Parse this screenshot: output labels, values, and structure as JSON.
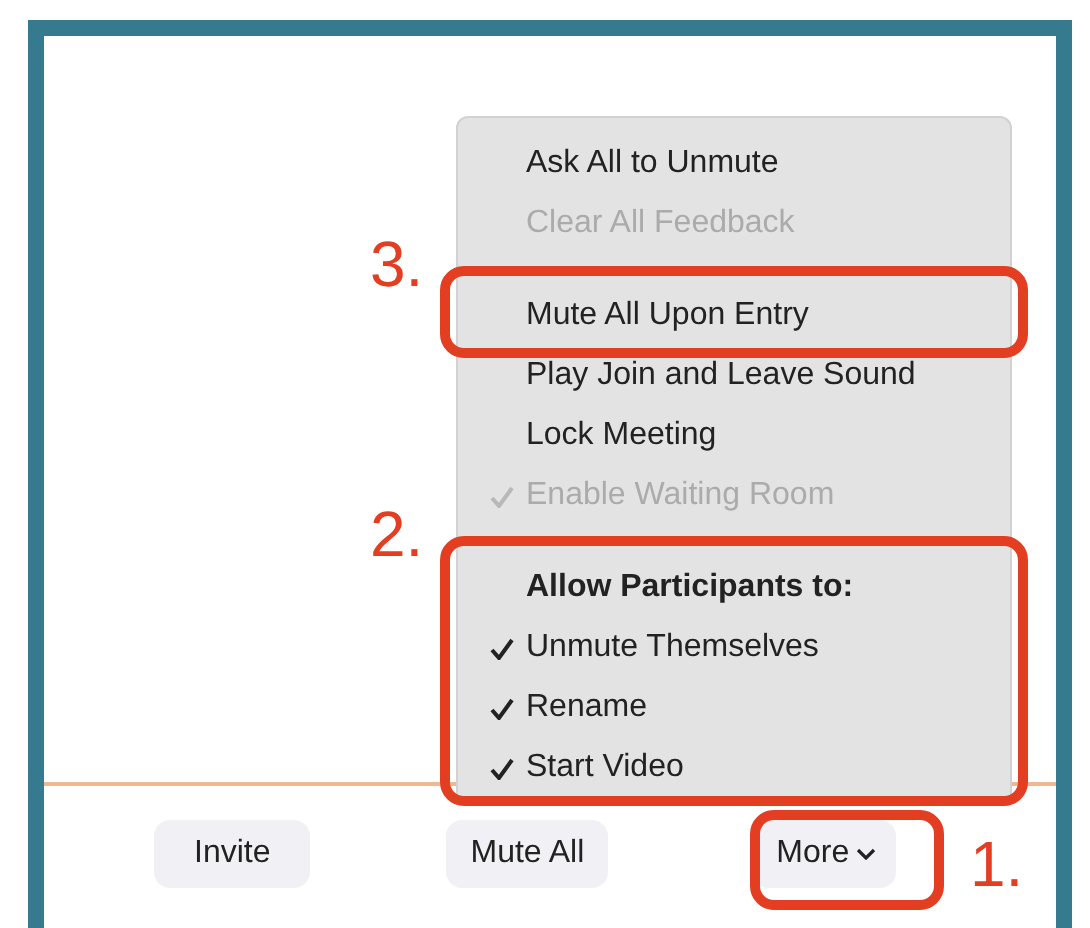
{
  "menu": {
    "items": [
      {
        "kind": "item",
        "label": "Ask All to Unmute",
        "disabled": false,
        "checked": false
      },
      {
        "kind": "item",
        "label": "Clear All Feedback",
        "disabled": true,
        "checked": false
      },
      {
        "kind": "separator"
      },
      {
        "kind": "item",
        "label": "Mute All Upon Entry",
        "disabled": false,
        "checked": false
      },
      {
        "kind": "item",
        "label": "Play Join and Leave Sound",
        "disabled": false,
        "checked": false
      },
      {
        "kind": "item",
        "label": "Lock Meeting",
        "disabled": false,
        "checked": false
      },
      {
        "kind": "item",
        "label": "Enable Waiting Room",
        "disabled": true,
        "checked": true
      },
      {
        "kind": "separator"
      },
      {
        "kind": "header",
        "label": "Allow Participants to:"
      },
      {
        "kind": "item",
        "label": "Unmute Themselves",
        "disabled": false,
        "checked": true
      },
      {
        "kind": "item",
        "label": "Rename",
        "disabled": false,
        "checked": true
      },
      {
        "kind": "item",
        "label": "Start Video",
        "disabled": false,
        "checked": true
      }
    ]
  },
  "buttons": [
    {
      "label": "Invite"
    },
    {
      "label": "Mute All"
    },
    {
      "label": "More",
      "dropdown": true
    }
  ],
  "annotations": [
    "3.",
    "2.",
    "1."
  ]
}
